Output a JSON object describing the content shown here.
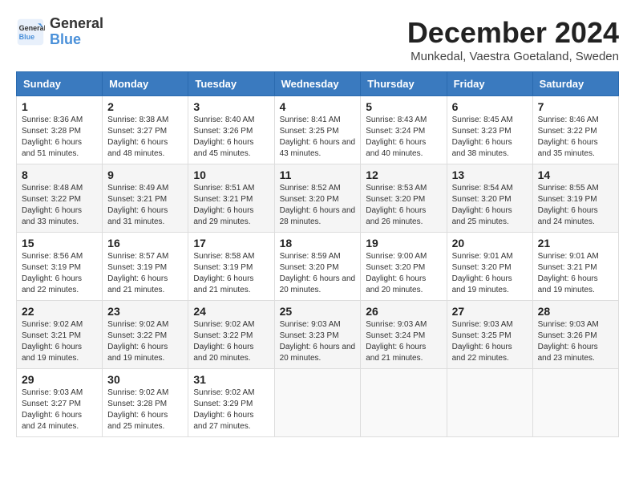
{
  "logo": {
    "line1": "General",
    "line2": "Blue"
  },
  "title": "December 2024",
  "location": "Munkedal, Vaestra Goetaland, Sweden",
  "days_of_week": [
    "Sunday",
    "Monday",
    "Tuesday",
    "Wednesday",
    "Thursday",
    "Friday",
    "Saturday"
  ],
  "weeks": [
    [
      {
        "day": "1",
        "sunrise": "8:36 AM",
        "sunset": "3:28 PM",
        "daylight": "6 hours and 51 minutes."
      },
      {
        "day": "2",
        "sunrise": "8:38 AM",
        "sunset": "3:27 PM",
        "daylight": "6 hours and 48 minutes."
      },
      {
        "day": "3",
        "sunrise": "8:40 AM",
        "sunset": "3:26 PM",
        "daylight": "6 hours and 45 minutes."
      },
      {
        "day": "4",
        "sunrise": "8:41 AM",
        "sunset": "3:25 PM",
        "daylight": "6 hours and 43 minutes."
      },
      {
        "day": "5",
        "sunrise": "8:43 AM",
        "sunset": "3:24 PM",
        "daylight": "6 hours and 40 minutes."
      },
      {
        "day": "6",
        "sunrise": "8:45 AM",
        "sunset": "3:23 PM",
        "daylight": "6 hours and 38 minutes."
      },
      {
        "day": "7",
        "sunrise": "8:46 AM",
        "sunset": "3:22 PM",
        "daylight": "6 hours and 35 minutes."
      }
    ],
    [
      {
        "day": "8",
        "sunrise": "8:48 AM",
        "sunset": "3:22 PM",
        "daylight": "6 hours and 33 minutes."
      },
      {
        "day": "9",
        "sunrise": "8:49 AM",
        "sunset": "3:21 PM",
        "daylight": "6 hours and 31 minutes."
      },
      {
        "day": "10",
        "sunrise": "8:51 AM",
        "sunset": "3:21 PM",
        "daylight": "6 hours and 29 minutes."
      },
      {
        "day": "11",
        "sunrise": "8:52 AM",
        "sunset": "3:20 PM",
        "daylight": "6 hours and 28 minutes."
      },
      {
        "day": "12",
        "sunrise": "8:53 AM",
        "sunset": "3:20 PM",
        "daylight": "6 hours and 26 minutes."
      },
      {
        "day": "13",
        "sunrise": "8:54 AM",
        "sunset": "3:20 PM",
        "daylight": "6 hours and 25 minutes."
      },
      {
        "day": "14",
        "sunrise": "8:55 AM",
        "sunset": "3:19 PM",
        "daylight": "6 hours and 24 minutes."
      }
    ],
    [
      {
        "day": "15",
        "sunrise": "8:56 AM",
        "sunset": "3:19 PM",
        "daylight": "6 hours and 22 minutes."
      },
      {
        "day": "16",
        "sunrise": "8:57 AM",
        "sunset": "3:19 PM",
        "daylight": "6 hours and 21 minutes."
      },
      {
        "day": "17",
        "sunrise": "8:58 AM",
        "sunset": "3:19 PM",
        "daylight": "6 hours and 21 minutes."
      },
      {
        "day": "18",
        "sunrise": "8:59 AM",
        "sunset": "3:20 PM",
        "daylight": "6 hours and 20 minutes."
      },
      {
        "day": "19",
        "sunrise": "9:00 AM",
        "sunset": "3:20 PM",
        "daylight": "6 hours and 20 minutes."
      },
      {
        "day": "20",
        "sunrise": "9:01 AM",
        "sunset": "3:20 PM",
        "daylight": "6 hours and 19 minutes."
      },
      {
        "day": "21",
        "sunrise": "9:01 AM",
        "sunset": "3:21 PM",
        "daylight": "6 hours and 19 minutes."
      }
    ],
    [
      {
        "day": "22",
        "sunrise": "9:02 AM",
        "sunset": "3:21 PM",
        "daylight": "6 hours and 19 minutes."
      },
      {
        "day": "23",
        "sunrise": "9:02 AM",
        "sunset": "3:22 PM",
        "daylight": "6 hours and 19 minutes."
      },
      {
        "day": "24",
        "sunrise": "9:02 AM",
        "sunset": "3:22 PM",
        "daylight": "6 hours and 20 minutes."
      },
      {
        "day": "25",
        "sunrise": "9:03 AM",
        "sunset": "3:23 PM",
        "daylight": "6 hours and 20 minutes."
      },
      {
        "day": "26",
        "sunrise": "9:03 AM",
        "sunset": "3:24 PM",
        "daylight": "6 hours and 21 minutes."
      },
      {
        "day": "27",
        "sunrise": "9:03 AM",
        "sunset": "3:25 PM",
        "daylight": "6 hours and 22 minutes."
      },
      {
        "day": "28",
        "sunrise": "9:03 AM",
        "sunset": "3:26 PM",
        "daylight": "6 hours and 23 minutes."
      }
    ],
    [
      {
        "day": "29",
        "sunrise": "9:03 AM",
        "sunset": "3:27 PM",
        "daylight": "6 hours and 24 minutes."
      },
      {
        "day": "30",
        "sunrise": "9:02 AM",
        "sunset": "3:28 PM",
        "daylight": "6 hours and 25 minutes."
      },
      {
        "day": "31",
        "sunrise": "9:02 AM",
        "sunset": "3:29 PM",
        "daylight": "6 hours and 27 minutes."
      },
      null,
      null,
      null,
      null
    ]
  ]
}
